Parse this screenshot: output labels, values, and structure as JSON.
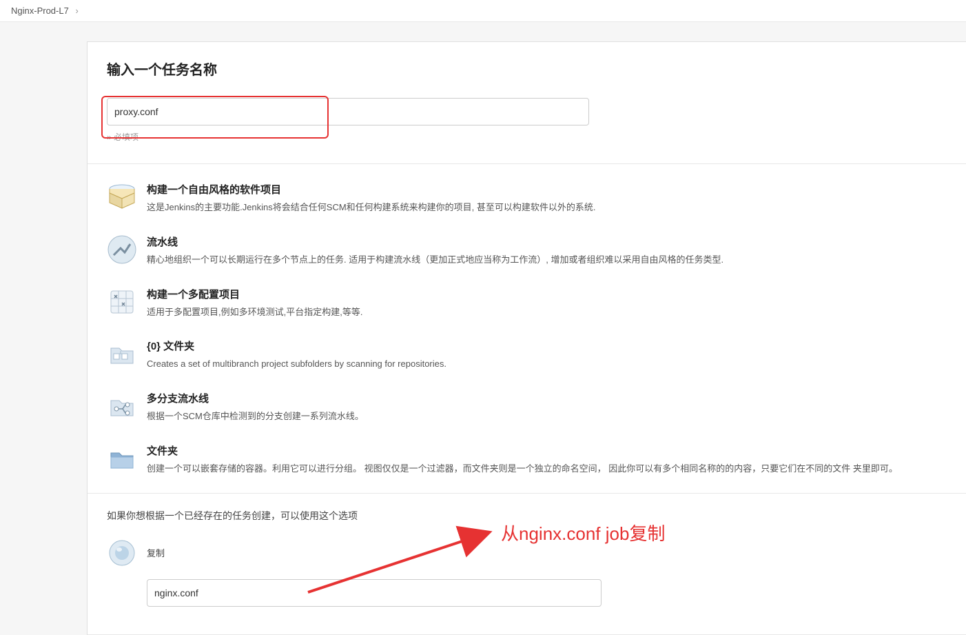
{
  "breadcrumb": {
    "item": "Nginx-Prod-L7"
  },
  "header": {
    "title": "输入一个任务名称",
    "name_value": "proxy.conf",
    "required_note": "» 必填项"
  },
  "item_types": [
    {
      "id": "freestyle",
      "icon": "box-icon",
      "title": "构建一个自由风格的软件项目",
      "desc": "这是Jenkins的主要功能.Jenkins将会结合任何SCM和任何构建系统来构建你的项目, 甚至可以构建软件以外的系统."
    },
    {
      "id": "pipeline",
      "icon": "pipeline-icon",
      "title": "流水线",
      "desc": "精心地组织一个可以长期运行在多个节点上的任务. 适用于构建流水线（更加正式地应当称为工作流）, 增加或者组织难以采用自由风格的任务类型."
    },
    {
      "id": "matrix",
      "icon": "matrix-icon",
      "title": "构建一个多配置项目",
      "desc": "适用于多配置项目,例如多环境测试,平台指定构建,等等."
    },
    {
      "id": "orgfolder",
      "icon": "org-folder-icon",
      "title": "{0} 文件夹",
      "desc": "Creates a set of multibranch project subfolders by scanning for repositories."
    },
    {
      "id": "multibranch",
      "icon": "branch-icon",
      "title": "多分支流水线",
      "desc": "根据一个SCM仓库中检测到的分支创建一系列流水线。"
    },
    {
      "id": "folder",
      "icon": "folder-icon",
      "title": "文件夹",
      "desc": "创建一个可以嵌套存储的容器。利用它可以进行分组。 视图仅仅是一个过滤器，而文件夹则是一个独立的命名空间， 因此你可以有多个相同名称的的内容，只要它们在不同的文件 夹里即可。"
    }
  ],
  "copy": {
    "hint": "如果你想根据一个已经存在的任务创建，可以使用这个选项",
    "label": "复制",
    "value": "nginx.conf"
  },
  "annotation": {
    "text": "从nginx.conf job复制"
  }
}
